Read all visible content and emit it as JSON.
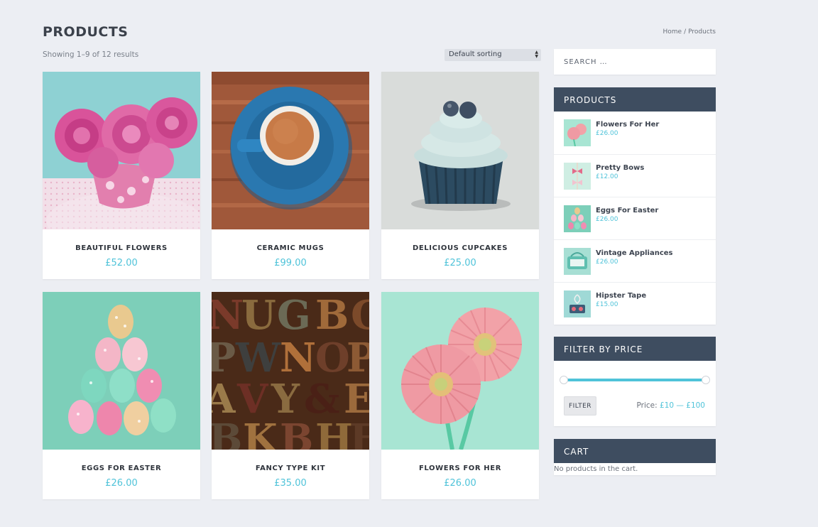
{
  "page": {
    "title": "PRODUCTS",
    "breadcrumb": {
      "home": "Home",
      "separator": "/",
      "current": "Products"
    },
    "result_count": "Showing 1–9 of 12 results",
    "sorting": {
      "selected": "Default sorting"
    }
  },
  "products": [
    {
      "name": "BEAUTIFUL FLOWERS",
      "price": "£52.00",
      "image": "pink-roses-in-cup"
    },
    {
      "name": "CERAMIC MUGS",
      "price": "£99.00",
      "image": "blue-coffee-cup"
    },
    {
      "name": "DELICIOUS CUPCAKES",
      "price": "£25.00",
      "image": "cupcake"
    },
    {
      "name": "EGGS FOR EASTER",
      "price": "£26.00",
      "image": "easter-eggs"
    },
    {
      "name": "FANCY TYPE KIT",
      "price": "£35.00",
      "image": "wooden-type-letters"
    },
    {
      "name": "FLOWERS FOR HER",
      "price": "£26.00",
      "image": "pink-gerbera-daisies"
    }
  ],
  "sidebar": {
    "search": {
      "placeholder": "SEARCH …"
    },
    "products_widget": {
      "title": "PRODUCTS",
      "items": [
        {
          "name": "Flowers For Her",
          "price": "£26.00"
        },
        {
          "name": "Pretty Bows",
          "price": "£12.00"
        },
        {
          "name": "Eggs For Easter",
          "price": "£26.00"
        },
        {
          "name": "Vintage Appliances",
          "price": "£26.00"
        },
        {
          "name": "Hipster Tape",
          "price": "£15.00"
        }
      ]
    },
    "filter_widget": {
      "title": "FILTER BY PRICE",
      "button": "FILTER",
      "price_prefix": "Price:",
      "min": "£10",
      "dash": "—",
      "max": "£100"
    },
    "cart_widget": {
      "title": "CART",
      "empty_text": "No products in the cart."
    }
  },
  "colors": {
    "accent": "#4fc3d9",
    "widget_header": "#3e4d60",
    "background": "#eceef3"
  }
}
